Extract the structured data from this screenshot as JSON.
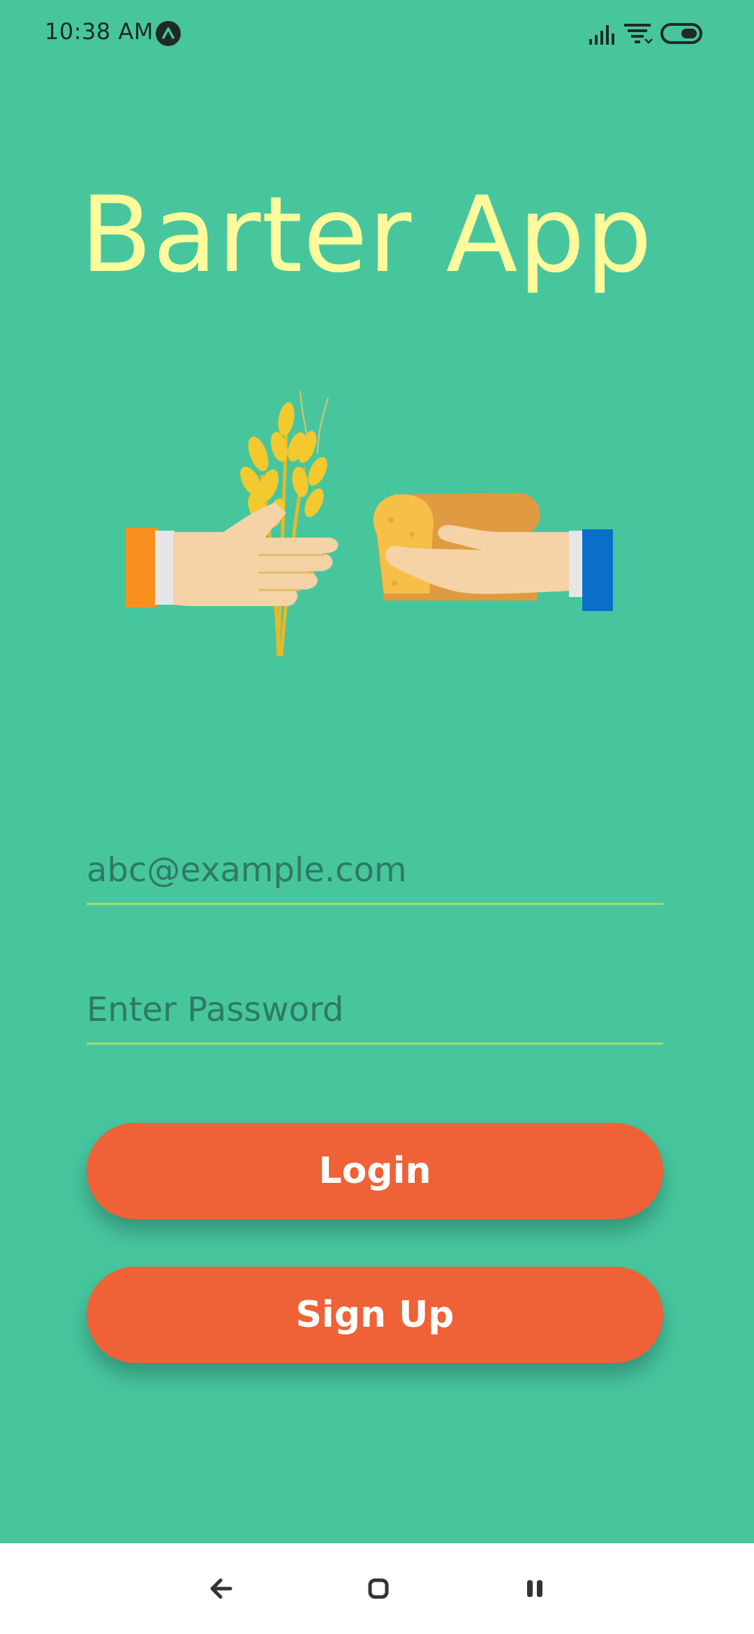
{
  "status_bar": {
    "time": "10:38 AM",
    "icons": [
      "app-notification-icon",
      "signal-icon",
      "wifi-icon",
      "battery-toggle-icon"
    ]
  },
  "app": {
    "title": "Barter App",
    "hero_image": "hands-exchanging-wheat-and-bread-illustration"
  },
  "form": {
    "email_placeholder": "abc@example.com",
    "password_placeholder": "Enter Password",
    "login_label": "Login",
    "signup_label": "Sign Up"
  },
  "nav_bar": {
    "icons": [
      "back-icon",
      "home-icon",
      "recents-icon"
    ]
  },
  "colors": {
    "background": "#47C69E",
    "title": "#FFFB9C",
    "button": "#EF6137",
    "underline": "#9BE06A",
    "placeholder": "#2E7A63"
  }
}
